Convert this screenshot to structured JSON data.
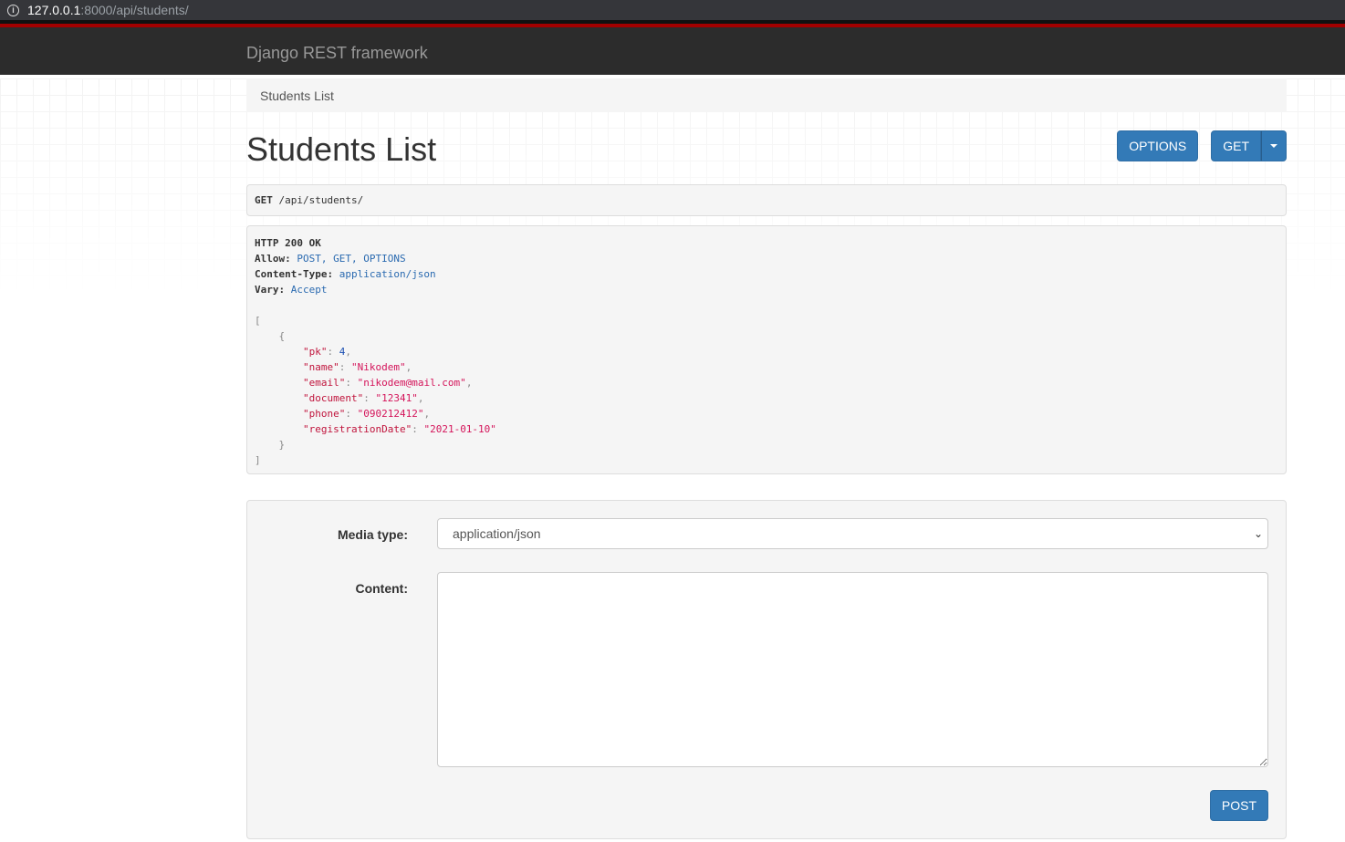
{
  "browser": {
    "url_host": "127.0.0.1",
    "url_rest": ":8000/api/students/"
  },
  "navbar": {
    "brand": "Django REST framework"
  },
  "breadcrumb": {
    "items": [
      "Students List"
    ]
  },
  "page": {
    "title": "Students List"
  },
  "buttons": {
    "options": "OPTIONS",
    "get": "GET",
    "post": "POST"
  },
  "request": {
    "method": "GET",
    "path": "/api/students/"
  },
  "response": {
    "status": "HTTP 200 OK",
    "headers": [
      {
        "name": "Allow:",
        "value": "POST, GET, OPTIONS"
      },
      {
        "name": "Content-Type:",
        "value": "application/json"
      },
      {
        "name": "Vary:",
        "value": "Accept"
      }
    ],
    "body": [
      {
        "pk": 4,
        "name": "Nikodem",
        "email": "nikodem@mail.com",
        "document": "12341",
        "phone": "090212412",
        "registrationDate": "2021-01-10"
      }
    ]
  },
  "form": {
    "media_type_label": "Media type:",
    "media_type_value": "application/json",
    "content_label": "Content:",
    "content_value": ""
  },
  "colors": {
    "accent": "#337ab7",
    "navbar": "#2c2c2c",
    "redline": "#a30000"
  }
}
